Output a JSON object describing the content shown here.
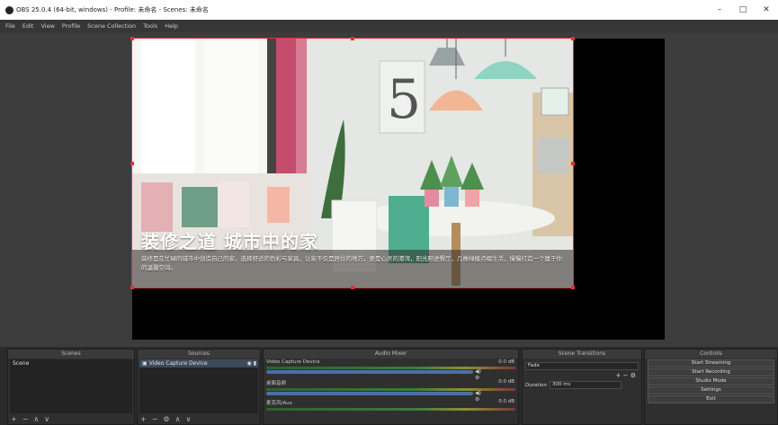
{
  "window": {
    "title": "OBS 25.0.4 (64-bit, windows) - Profile: 未命名 - Scenes: 未命名",
    "minimize": "–",
    "maximize": "□",
    "close": "✕"
  },
  "menu": [
    "File",
    "Edit",
    "View",
    "Profile",
    "Scene Collection",
    "Tools",
    "Help"
  ],
  "preview": {
    "headline": "装修之道 城市中的家",
    "body": "装修是在忙碌的城市中创造自己的家，选择舒适的色彩与家具，让家不仅是居住的地方，更是心灵的港湾，阳光照进餐厅，几株绿植点缀生活，慢慢打造一个属于你的温馨空间。"
  },
  "docks": {
    "scenes": {
      "header": "Scenes",
      "items": [
        "Scene"
      ]
    },
    "sources": {
      "header": "Sources",
      "items": [
        "Video Capture Device"
      ]
    },
    "mixer": {
      "header": "Audio Mixer",
      "channels": [
        {
          "name": "Video Capture Device",
          "db": "0.0 dB"
        },
        {
          "name": "桌面音频",
          "db": "0.0 dB"
        },
        {
          "name": "麦克风/Aux",
          "db": "0.0 dB"
        }
      ]
    },
    "transitions": {
      "header": "Scene Transitions",
      "type": "Fade",
      "duration_label": "Duration",
      "duration": "300 ms"
    },
    "controls": {
      "header": "Controls",
      "buttons": [
        "Start Streaming",
        "Start Recording",
        "Studio Mode",
        "Settings",
        "Exit"
      ]
    }
  },
  "footer_icons": [
    "+",
    "−",
    "∧",
    "∨"
  ],
  "sources_footer_icons": [
    "+",
    "−",
    "⚙",
    "∧",
    "∨"
  ]
}
